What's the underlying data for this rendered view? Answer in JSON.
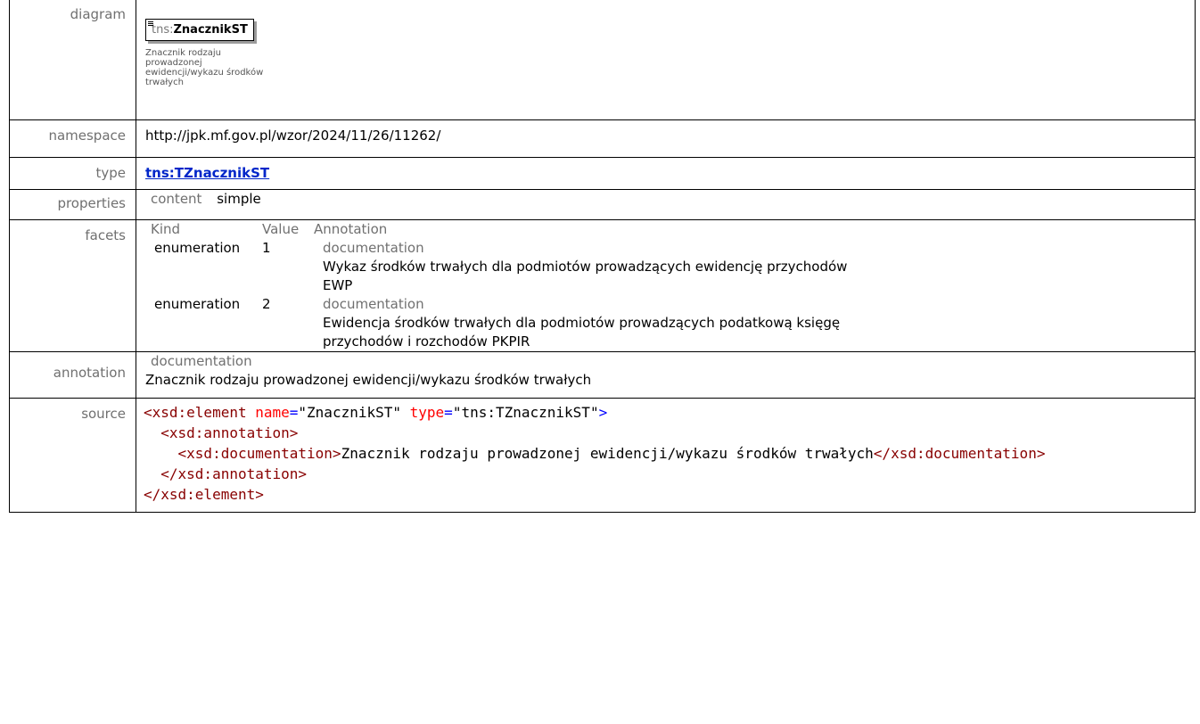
{
  "rows": {
    "diagram": {
      "label": "diagram",
      "element_ns": "tns:",
      "element_name": "ZnacznikST",
      "element_doc": "Znacznik rodzaju prowadzonej ewidencji/wykazu środków trwałych"
    },
    "namespace": {
      "label": "namespace",
      "value": "http://jpk.mf.gov.pl/wzor/2024/11/26/11262/"
    },
    "type": {
      "label": "type",
      "value": "tns:TZnacznikST"
    },
    "properties": {
      "label": "properties",
      "key": "content",
      "value": "simple"
    },
    "facets": {
      "label": "facets",
      "headers": [
        "Kind",
        "Value",
        "Annotation"
      ],
      "items": [
        {
          "kind": "enumeration",
          "value": "1",
          "doc_label": "documentation",
          "doc_line1": "Wykaz środków trwałych dla podmiotów prowadzących ewidencję przychodów",
          "doc_line2": "EWP"
        },
        {
          "kind": "enumeration",
          "value": "2",
          "doc_label": "documentation",
          "doc_line1": "Ewidencja środków trwałych dla podmiotów prowadzących podatkową księgę",
          "doc_line2": "przychodów i rozchodów PKPIR"
        }
      ]
    },
    "annotation": {
      "label": "annotation",
      "doc_label": "documentation",
      "text": "Znacznik rodzaju prowadzonej ewidencji/wykazu środków trwałych"
    },
    "source": {
      "label": "source",
      "line1_open": "<xsd:element",
      "line1_attr1": "name",
      "line1_val1": "\"ZnacznikST\"",
      "line1_attr2": "type",
      "line1_val2": "\"tns:TZnacznikST\"",
      "line1_close": ">",
      "line2": "<xsd:annotation>",
      "line3_open": "<xsd:documentation>",
      "line3_text": "Znacznik rodzaju prowadzonej ewidencji/wykazu środków trwałych",
      "line3_close": "</xsd:documentation>",
      "line4": "</xsd:annotation>",
      "line5": "</xsd:element>"
    }
  }
}
